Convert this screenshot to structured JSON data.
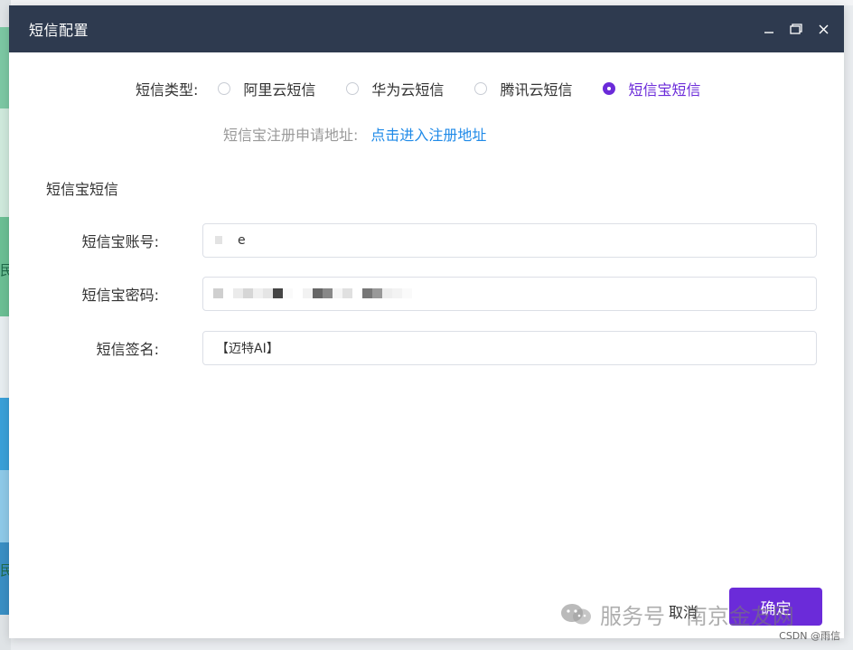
{
  "dialog": {
    "title": "短信配置"
  },
  "sms_type": {
    "label": "短信类型:",
    "options": [
      {
        "label": "阿里云短信",
        "selected": false
      },
      {
        "label": "华为云短信",
        "selected": false
      },
      {
        "label": "腾讯云短信",
        "selected": false
      },
      {
        "label": "短信宝短信",
        "selected": true
      }
    ]
  },
  "register": {
    "label": "短信宝注册申请地址:",
    "link_text": "点击进入注册地址"
  },
  "section": {
    "title": "短信宝短信"
  },
  "form": {
    "account": {
      "label": "短信宝账号:",
      "value": "e"
    },
    "password": {
      "label": "短信宝密码:",
      "value": ""
    },
    "signature": {
      "label": "短信签名:",
      "value": "【迈特AI】"
    }
  },
  "footer": {
    "cancel_label": "取消",
    "ok_label": "确定"
  },
  "watermark": {
    "text": "服务号 · 南京金友网",
    "credit": "CSDN @雨信"
  },
  "background": {
    "glyphs": [
      "民",
      "民"
    ]
  },
  "colors": {
    "titlebar": "#2e3a4f",
    "accent": "#6b2bd9",
    "link": "#1f8ae8"
  },
  "icons": {
    "minimize": "minimize-icon",
    "maximize": "maximize-icon",
    "close": "close-icon",
    "wechat": "wechat-icon"
  }
}
